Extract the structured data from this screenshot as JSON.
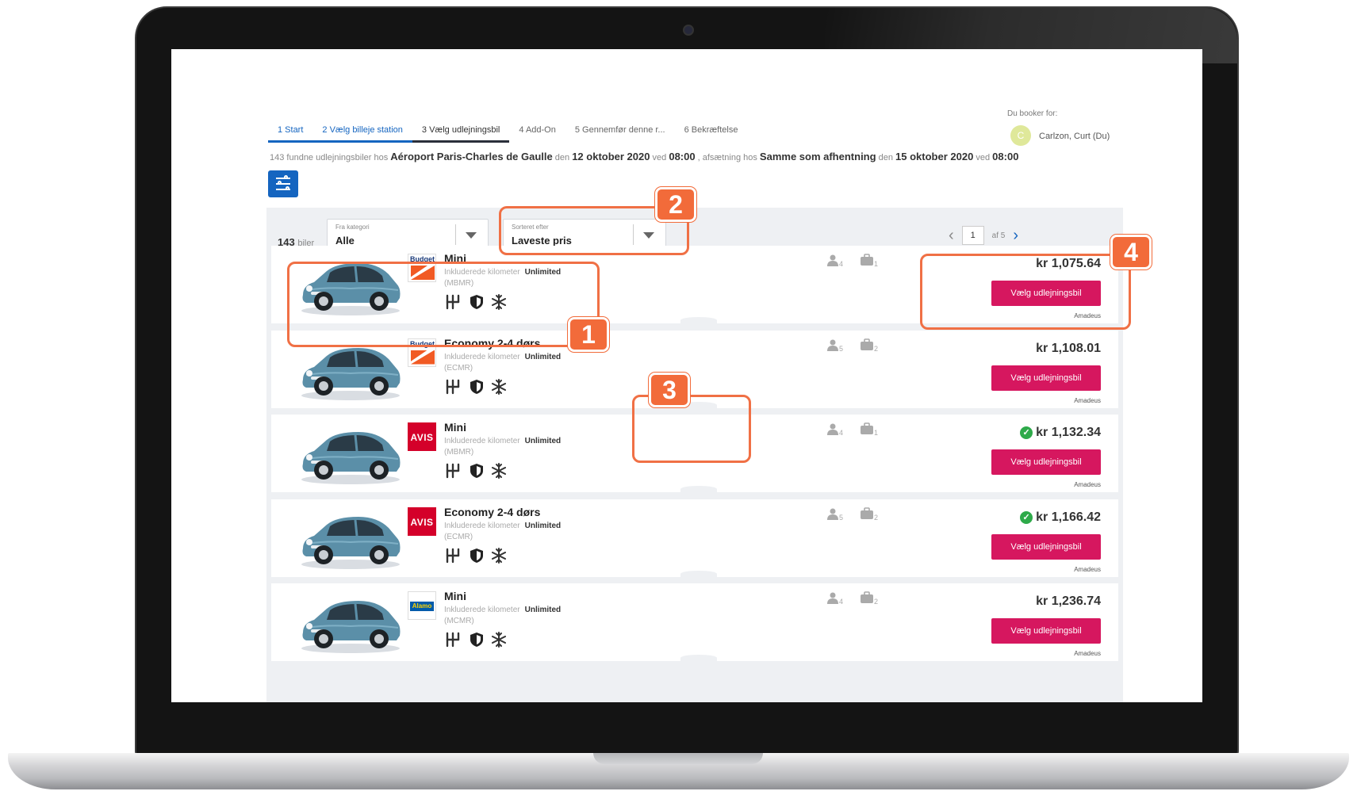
{
  "stepper": [
    {
      "label": "1  Start",
      "state": "done"
    },
    {
      "label": "2  Vælg billeje station",
      "state": "done"
    },
    {
      "label": "3  Vælg udlejningsbil",
      "state": "active"
    },
    {
      "label": "4  Add-On",
      "state": "todo"
    },
    {
      "label": "5  Gennemfør denne r...",
      "state": "todo"
    },
    {
      "label": "6  Bekræftelse",
      "state": "todo"
    }
  ],
  "booker": {
    "label": "Du booker for:",
    "initial": "C",
    "name": "Carlzon, Curt (Du)"
  },
  "summary": {
    "p1": "143 fundne udlejningsbiler hos ",
    "location": "Aéroport Paris-Charles de Gaulle",
    "p2": " den ",
    "pickup_date": "12 oktober 2020",
    "p3": " ved ",
    "pickup_time": "08:00",
    "p4": " , afsætning hos ",
    "dropoff": "Samme som afhentning",
    "p5": " den ",
    "dropoff_date": "15 oktober 2020",
    "p6": " ved ",
    "dropoff_time": "08:00"
  },
  "results": {
    "count": "143",
    "count_unit": "biler",
    "category": {
      "label": "Fra kategori",
      "value": "Alle"
    },
    "sort": {
      "label": "Sorteret efter",
      "value": "Laveste pris"
    },
    "pager": {
      "page": "1",
      "of": "af 5"
    }
  },
  "cars": [
    {
      "vendor": "Budget",
      "vendor_type": "budget",
      "name": "Mini",
      "km_label": "Inkluderede kilometer",
      "km_value": "Unlimited",
      "code": "(MBMR)",
      "seats": "4",
      "bags": "1",
      "price": "kr 1,075.64",
      "verified": false,
      "button": "Vælg udlejningsbil",
      "provider": "Amadeus"
    },
    {
      "vendor": "Budget",
      "vendor_type": "budget",
      "name": "Economy 2-4 dørs",
      "km_label": "Inkluderede kilometer",
      "km_value": "Unlimited",
      "code": "(ECMR)",
      "seats": "5",
      "bags": "2",
      "price": "kr 1,108.01",
      "verified": false,
      "button": "Vælg udlejningsbil",
      "provider": "Amadeus"
    },
    {
      "vendor": "AVIS",
      "vendor_type": "avis",
      "name": "Mini",
      "km_label": "Inkluderede kilometer",
      "km_value": "Unlimited",
      "code": "(MBMR)",
      "seats": "4",
      "bags": "1",
      "price": "kr 1,132.34",
      "verified": true,
      "button": "Vælg udlejningsbil",
      "provider": "Amadeus"
    },
    {
      "vendor": "AVIS",
      "vendor_type": "avis",
      "name": "Economy 2-4 dørs",
      "km_label": "Inkluderede kilometer",
      "km_value": "Unlimited",
      "code": "(ECMR)",
      "seats": "5",
      "bags": "2",
      "price": "kr 1,166.42",
      "verified": true,
      "button": "Vælg udlejningsbil",
      "provider": "Amadeus"
    },
    {
      "vendor": "Alamo",
      "vendor_type": "alamo",
      "name": "Mini",
      "km_label": "Inkluderede kilometer",
      "km_value": "Unlimited",
      "code": "(MCMR)",
      "seats": "4",
      "bags": "2",
      "price": "kr 1,236.74",
      "verified": false,
      "button": "Vælg udlejningsbil",
      "provider": "Amadeus"
    }
  ],
  "callouts": [
    "1",
    "2",
    "3",
    "4"
  ],
  "colors": {
    "accent_blue": "#1565c0",
    "book_button": "#d6175f",
    "callout": "#f26b3a",
    "verified": "#2eaa4a"
  },
  "icons": {
    "filter": "sliders-icon",
    "gear": "manual-transmission-icon",
    "shield": "shield-icon",
    "ac": "snowflake-icon",
    "seats": "person-icon",
    "bags": "suitcase-icon"
  }
}
